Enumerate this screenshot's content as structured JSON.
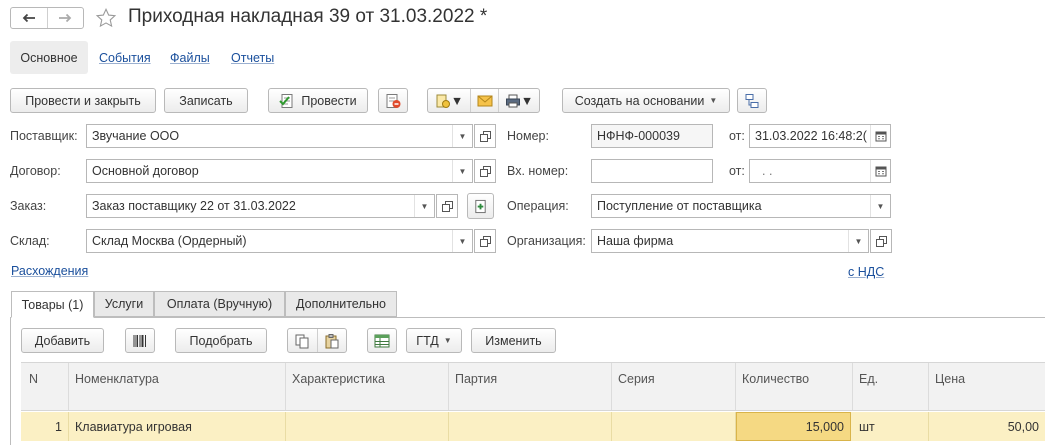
{
  "window": {
    "title": "Приходная накладная 39 от 31.03.2022 *"
  },
  "section_tabs": [
    {
      "label": "Основное",
      "active": true
    },
    {
      "label": "События"
    },
    {
      "label": "Файлы"
    },
    {
      "label": "Отчеты"
    }
  ],
  "toolbar": {
    "post_close": "Провести и закрыть",
    "save": "Записать",
    "post": "Провести",
    "create_based": "Создать на основании"
  },
  "form": {
    "supplier": {
      "label": "Поставщик:",
      "value": "Звучание ООО"
    },
    "contract": {
      "label": "Договор:",
      "value": "Основной договор"
    },
    "order": {
      "label": "Заказ:",
      "value": "Заказ поставщику 22 от 31.03.2022"
    },
    "warehouse": {
      "label": "Склад:",
      "value": "Склад Москва (Ордерный)"
    },
    "number": {
      "label": "Номер:",
      "value": "НФНФ-000039"
    },
    "date": {
      "label": "от:",
      "value": "31.03.2022 16:48:2("
    },
    "incoming_number": {
      "label": "Вх. номер:",
      "value": ""
    },
    "incoming_date": {
      "label": "от:",
      "value": ".  ."
    },
    "operation": {
      "label": "Операция:",
      "value": "Поступление от поставщика"
    },
    "organization": {
      "label": "Организация:",
      "value": "Наша фирма"
    },
    "discrepancies_link": "Расхождения",
    "vat_link": "с НДС"
  },
  "inner_tabs": [
    {
      "label": "Товары (1)",
      "active": true
    },
    {
      "label": "Услуги"
    },
    {
      "label": "Оплата (Вручную)"
    },
    {
      "label": "Дополнительно"
    }
  ],
  "table_toolbar": {
    "add": "Добавить",
    "pick": "Подобрать",
    "gtd": "ГТД",
    "change": "Изменить"
  },
  "table": {
    "columns": [
      "N",
      "Номенклатура",
      "Характеристика",
      "Партия",
      "Серия",
      "Количество",
      "Ед.",
      "Цена"
    ],
    "rows": [
      {
        "n": "1",
        "item": "Клавиатура игровая",
        "characteristic": "",
        "batch": "",
        "series": "",
        "quantity": "15,000",
        "unit": "шт",
        "price": "50,00"
      }
    ]
  },
  "colors": {
    "link": "#1a4f9c",
    "row_selected": "#fbf0c4",
    "cell_selected": "#f5d983",
    "header_bg": "#f2f2f2"
  }
}
